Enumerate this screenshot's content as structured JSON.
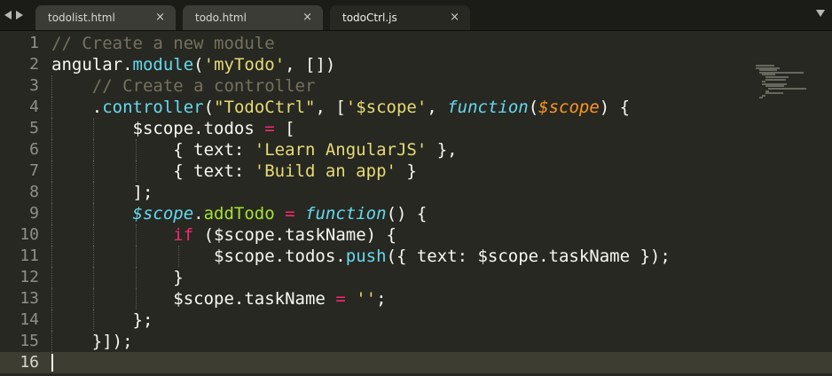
{
  "tabs": [
    {
      "label": "todolist.html",
      "close": "×",
      "active": false
    },
    {
      "label": "todo.html",
      "close": "×",
      "active": false
    },
    {
      "label": "todoCtrl.js",
      "close": "×",
      "active": true
    }
  ],
  "gutter": [
    "1",
    "2",
    "3",
    "4",
    "5",
    "6",
    "7",
    "8",
    "9",
    "10",
    "11",
    "12",
    "13",
    "14",
    "15",
    "16"
  ],
  "code": {
    "l1": {
      "t1": "// Create a new module"
    },
    "l2": {
      "t1": "angular",
      "t2": ".",
      "t3": "module",
      "t4": "(",
      "t5": "'myTodo'",
      "t6": ", [])"
    },
    "l3": {
      "t1": "// Create a controller"
    },
    "l4": {
      "t1": ".",
      "t2": "controller",
      "t3": "(",
      "t4": "\"TodoCtrl\"",
      "t5": ", [",
      "t6": "'$scope'",
      "t7": ", ",
      "t8": "function",
      "t9": "(",
      "t10": "$scope",
      "t11": ") {"
    },
    "l5": {
      "t1": "$scope.todos ",
      "t2": "=",
      "t3": " ["
    },
    "l6": {
      "t1": "{ text: ",
      "t2": "'Learn AngularJS'",
      "t3": " },"
    },
    "l7": {
      "t1": "{ text: ",
      "t2": "'Build an app'",
      "t3": " }"
    },
    "l8": {
      "t1": "];"
    },
    "l9": {
      "t1": "$scope",
      "t2": ".",
      "t3": "addTodo",
      "t4": " ",
      "t5": "=",
      "t6": " ",
      "t7": "function",
      "t8": "() {"
    },
    "l10": {
      "t1": "if",
      "t2": " ($scope.taskName) {"
    },
    "l11": {
      "t1": "$scope.todos.",
      "t2": "push",
      "t3": "({ text: $scope.taskName });"
    },
    "l12": {
      "t1": "}"
    },
    "l13": {
      "t1": "$scope.taskName ",
      "t2": "=",
      "t3": " ",
      "t4": "''",
      "t5": ";"
    },
    "l14": {
      "t1": "};"
    },
    "l15": {
      "t1": "}]);"
    },
    "l16": {
      "t1": ""
    }
  },
  "colors": {
    "background": "#272822",
    "comment": "#75715e",
    "string": "#e6db74",
    "keyword": "#f92672",
    "function": "#66d9ef",
    "parameter": "#fd971f",
    "method": "#a6e22e"
  },
  "icons": [
    "nav-left-icon",
    "nav-right-icon",
    "close-icon",
    "tab-menu-icon"
  ]
}
